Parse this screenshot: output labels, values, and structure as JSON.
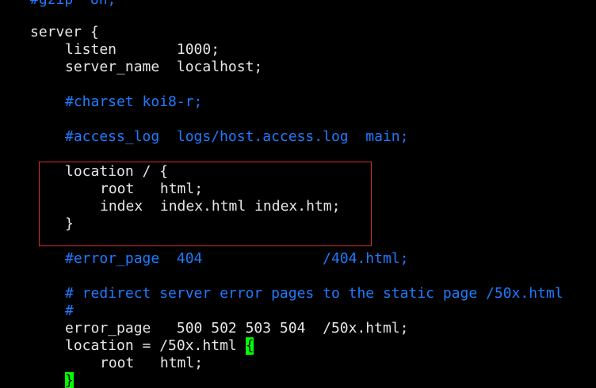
{
  "colors": {
    "background": "#000000",
    "text": "#e6e6e6",
    "comment": "#1f7bff",
    "highlight_box": "#d62e2e",
    "match_brace_bg": "#00ff00"
  },
  "editor": {
    "lines": {
      "l0": "#gzip  on;",
      "l1": "server {",
      "l2": "listen       1000;",
      "l3": "server_name  localhost;",
      "l4": "#charset koi8-r;",
      "l5": "#access_log  logs/host.access.log  main;",
      "l6": "location / {",
      "l7": "root   html;",
      "l8": "index  index.html index.htm;",
      "l9": "}",
      "l10": "#error_page  404              /404.html;",
      "l11": "# redirect server error pages to the static page /50x.html",
      "l12": "#",
      "l13": "error_page   500 502 503 504  /50x.html;",
      "l14_prefix": "location = /50x.html ",
      "l14_brace": "{",
      "l15": "root   html;",
      "l16": "}"
    }
  }
}
